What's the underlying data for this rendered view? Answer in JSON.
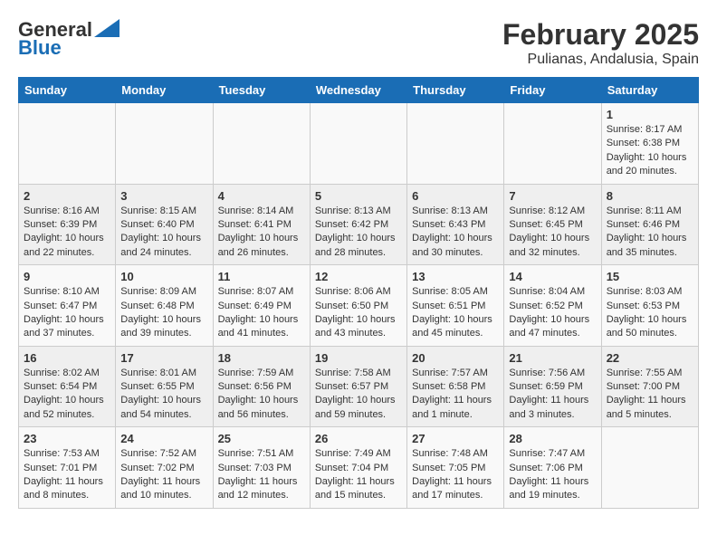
{
  "logo": {
    "general": "General",
    "blue": "Blue"
  },
  "title": "February 2025",
  "subtitle": "Pulianas, Andalusia, Spain",
  "days_of_week": [
    "Sunday",
    "Monday",
    "Tuesday",
    "Wednesday",
    "Thursday",
    "Friday",
    "Saturday"
  ],
  "weeks": [
    [
      {
        "day": "",
        "content": ""
      },
      {
        "day": "",
        "content": ""
      },
      {
        "day": "",
        "content": ""
      },
      {
        "day": "",
        "content": ""
      },
      {
        "day": "",
        "content": ""
      },
      {
        "day": "",
        "content": ""
      },
      {
        "day": "1",
        "content": "Sunrise: 8:17 AM\nSunset: 6:38 PM\nDaylight: 10 hours and 20 minutes."
      }
    ],
    [
      {
        "day": "2",
        "content": "Sunrise: 8:16 AM\nSunset: 6:39 PM\nDaylight: 10 hours and 22 minutes."
      },
      {
        "day": "3",
        "content": "Sunrise: 8:15 AM\nSunset: 6:40 PM\nDaylight: 10 hours and 24 minutes."
      },
      {
        "day": "4",
        "content": "Sunrise: 8:14 AM\nSunset: 6:41 PM\nDaylight: 10 hours and 26 minutes."
      },
      {
        "day": "5",
        "content": "Sunrise: 8:13 AM\nSunset: 6:42 PM\nDaylight: 10 hours and 28 minutes."
      },
      {
        "day": "6",
        "content": "Sunrise: 8:13 AM\nSunset: 6:43 PM\nDaylight: 10 hours and 30 minutes."
      },
      {
        "day": "7",
        "content": "Sunrise: 8:12 AM\nSunset: 6:45 PM\nDaylight: 10 hours and 32 minutes."
      },
      {
        "day": "8",
        "content": "Sunrise: 8:11 AM\nSunset: 6:46 PM\nDaylight: 10 hours and 35 minutes."
      }
    ],
    [
      {
        "day": "9",
        "content": "Sunrise: 8:10 AM\nSunset: 6:47 PM\nDaylight: 10 hours and 37 minutes."
      },
      {
        "day": "10",
        "content": "Sunrise: 8:09 AM\nSunset: 6:48 PM\nDaylight: 10 hours and 39 minutes."
      },
      {
        "day": "11",
        "content": "Sunrise: 8:07 AM\nSunset: 6:49 PM\nDaylight: 10 hours and 41 minutes."
      },
      {
        "day": "12",
        "content": "Sunrise: 8:06 AM\nSunset: 6:50 PM\nDaylight: 10 hours and 43 minutes."
      },
      {
        "day": "13",
        "content": "Sunrise: 8:05 AM\nSunset: 6:51 PM\nDaylight: 10 hours and 45 minutes."
      },
      {
        "day": "14",
        "content": "Sunrise: 8:04 AM\nSunset: 6:52 PM\nDaylight: 10 hours and 47 minutes."
      },
      {
        "day": "15",
        "content": "Sunrise: 8:03 AM\nSunset: 6:53 PM\nDaylight: 10 hours and 50 minutes."
      }
    ],
    [
      {
        "day": "16",
        "content": "Sunrise: 8:02 AM\nSunset: 6:54 PM\nDaylight: 10 hours and 52 minutes."
      },
      {
        "day": "17",
        "content": "Sunrise: 8:01 AM\nSunset: 6:55 PM\nDaylight: 10 hours and 54 minutes."
      },
      {
        "day": "18",
        "content": "Sunrise: 7:59 AM\nSunset: 6:56 PM\nDaylight: 10 hours and 56 minutes."
      },
      {
        "day": "19",
        "content": "Sunrise: 7:58 AM\nSunset: 6:57 PM\nDaylight: 10 hours and 59 minutes."
      },
      {
        "day": "20",
        "content": "Sunrise: 7:57 AM\nSunset: 6:58 PM\nDaylight: 11 hours and 1 minute."
      },
      {
        "day": "21",
        "content": "Sunrise: 7:56 AM\nSunset: 6:59 PM\nDaylight: 11 hours and 3 minutes."
      },
      {
        "day": "22",
        "content": "Sunrise: 7:55 AM\nSunset: 7:00 PM\nDaylight: 11 hours and 5 minutes."
      }
    ],
    [
      {
        "day": "23",
        "content": "Sunrise: 7:53 AM\nSunset: 7:01 PM\nDaylight: 11 hours and 8 minutes."
      },
      {
        "day": "24",
        "content": "Sunrise: 7:52 AM\nSunset: 7:02 PM\nDaylight: 11 hours and 10 minutes."
      },
      {
        "day": "25",
        "content": "Sunrise: 7:51 AM\nSunset: 7:03 PM\nDaylight: 11 hours and 12 minutes."
      },
      {
        "day": "26",
        "content": "Sunrise: 7:49 AM\nSunset: 7:04 PM\nDaylight: 11 hours and 15 minutes."
      },
      {
        "day": "27",
        "content": "Sunrise: 7:48 AM\nSunset: 7:05 PM\nDaylight: 11 hours and 17 minutes."
      },
      {
        "day": "28",
        "content": "Sunrise: 7:47 AM\nSunset: 7:06 PM\nDaylight: 11 hours and 19 minutes."
      },
      {
        "day": "",
        "content": ""
      }
    ]
  ]
}
